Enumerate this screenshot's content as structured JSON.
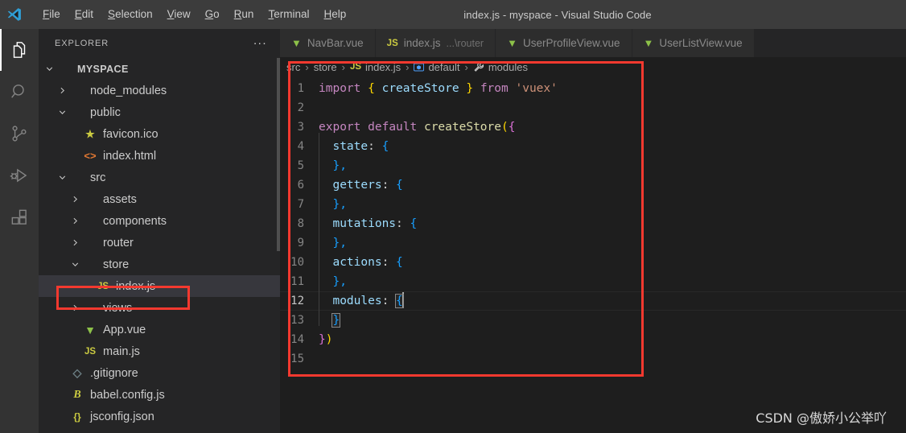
{
  "window": {
    "title": "index.js - myspace - Visual Studio Code",
    "logo_icon": "vscode-logo-icon"
  },
  "menubar": {
    "items": [
      {
        "label": "File",
        "mnemonic": "F"
      },
      {
        "label": "Edit",
        "mnemonic": "E"
      },
      {
        "label": "Selection",
        "mnemonic": "S"
      },
      {
        "label": "View",
        "mnemonic": "V"
      },
      {
        "label": "Go",
        "mnemonic": "G"
      },
      {
        "label": "Run",
        "mnemonic": "R"
      },
      {
        "label": "Terminal",
        "mnemonic": "T"
      },
      {
        "label": "Help",
        "mnemonic": "H"
      }
    ]
  },
  "activitybar": {
    "items": [
      {
        "name": "explorer-icon",
        "active": true
      },
      {
        "name": "search-icon",
        "active": false
      },
      {
        "name": "source-control-icon",
        "active": false
      },
      {
        "name": "run-and-debug-icon",
        "active": false
      },
      {
        "name": "extensions-icon",
        "active": false
      }
    ]
  },
  "sidebar": {
    "title": "EXPLORER",
    "overflow_label": "...",
    "tree": [
      {
        "label": "MYSPACE",
        "depth": 0,
        "twisty": "down",
        "icon": "none",
        "selected": false,
        "root": true
      },
      {
        "label": "node_modules",
        "depth": 1,
        "twisty": "right",
        "icon": "none",
        "selected": false
      },
      {
        "label": "public",
        "depth": 1,
        "twisty": "down",
        "icon": "none",
        "selected": false
      },
      {
        "label": "favicon.ico",
        "depth": 2,
        "twisty": "none",
        "icon": "star",
        "selected": false
      },
      {
        "label": "index.html",
        "depth": 2,
        "twisty": "none",
        "icon": "html",
        "selected": false
      },
      {
        "label": "src",
        "depth": 1,
        "twisty": "down",
        "icon": "none",
        "selected": false
      },
      {
        "label": "assets",
        "depth": 2,
        "twisty": "right",
        "icon": "none",
        "selected": false
      },
      {
        "label": "components",
        "depth": 2,
        "twisty": "right",
        "icon": "none",
        "selected": false
      },
      {
        "label": "router",
        "depth": 2,
        "twisty": "right",
        "icon": "none",
        "selected": false
      },
      {
        "label": "store",
        "depth": 2,
        "twisty": "down",
        "icon": "none",
        "selected": false
      },
      {
        "label": "index.js",
        "depth": 3,
        "twisty": "none",
        "icon": "js",
        "selected": true
      },
      {
        "label": "views",
        "depth": 2,
        "twisty": "right",
        "icon": "none",
        "selected": false
      },
      {
        "label": "App.vue",
        "depth": 2,
        "twisty": "none",
        "icon": "vue",
        "selected": false
      },
      {
        "label": "main.js",
        "depth": 2,
        "twisty": "none",
        "icon": "js",
        "selected": false
      },
      {
        "label": ".gitignore",
        "depth": 1,
        "twisty": "none",
        "icon": "git",
        "selected": false
      },
      {
        "label": "babel.config.js",
        "depth": 1,
        "twisty": "none",
        "icon": "babel",
        "selected": false
      },
      {
        "label": "jsconfig.json",
        "depth": 1,
        "twisty": "none",
        "icon": "json",
        "selected": false
      }
    ]
  },
  "tabs": [
    {
      "label": "NavBar.vue",
      "icon": "vue-file-icon",
      "sub": "",
      "active": false
    },
    {
      "label": "index.js",
      "icon": "js-file-icon",
      "sub": "...\\router",
      "active": false
    },
    {
      "label": "UserProfileView.vue",
      "icon": "vue-file-icon",
      "sub": "",
      "active": false
    },
    {
      "label": "UserListView.vue",
      "icon": "vue-file-icon",
      "sub": "",
      "active": false
    }
  ],
  "breadcrumbs": [
    {
      "label": "src",
      "icon": "none"
    },
    {
      "label": "store",
      "icon": "none"
    },
    {
      "label": "index.js",
      "icon": "js-file-icon"
    },
    {
      "label": "default",
      "icon": "symbol-object-icon"
    },
    {
      "label": "modules",
      "icon": "symbol-property-icon"
    }
  ],
  "code": {
    "lines": [
      {
        "num": "1",
        "active": false
      },
      {
        "num": "2",
        "active": false
      },
      {
        "num": "3",
        "active": false
      },
      {
        "num": "4",
        "active": false
      },
      {
        "num": "5",
        "active": false
      },
      {
        "num": "6",
        "active": false
      },
      {
        "num": "7",
        "active": false
      },
      {
        "num": "8",
        "active": false
      },
      {
        "num": "9",
        "active": false
      },
      {
        "num": "10",
        "active": false
      },
      {
        "num": "11",
        "active": false
      },
      {
        "num": "12",
        "active": true
      },
      {
        "num": "13",
        "active": false
      },
      {
        "num": "14",
        "active": false
      },
      {
        "num": "15",
        "active": false
      }
    ],
    "text": {
      "l1_import": "import",
      "l1_brace_open": "{",
      "l1_createstore": " createStore ",
      "l1_brace_close": "}",
      "l1_from": "from",
      "l1_string": "'vuex'",
      "l3_export": "export",
      "l3_default": "default",
      "l3_createstore": "createStore",
      "l3_paren": "(",
      "l3_brace": "{",
      "l4_prop": "state",
      "l4_colon": ": ",
      "l4_brace": "{",
      "l5_close": "},",
      "l6_prop": "getters",
      "l6_colon": ": ",
      "l6_brace": "{",
      "l7_close": "},",
      "l8_prop": "mutations",
      "l8_colon": ": ",
      "l8_brace": "{",
      "l9_close": "},",
      "l10_prop": "actions",
      "l10_colon": ": ",
      "l10_brace": "{",
      "l11_close": "},",
      "l12_prop": "modules",
      "l12_colon": ": ",
      "l12_brace": "{",
      "l13_brace": "}",
      "l14_brace": "}",
      "l14_paren": ")"
    }
  },
  "annotations": [
    {
      "name": "editor-highlight-box",
      "color": "#f4392f"
    },
    {
      "name": "sidebar-highlight-box",
      "color": "#f4392f"
    }
  ],
  "watermark": {
    "text": "CSDN @傲娇小公举吖"
  }
}
